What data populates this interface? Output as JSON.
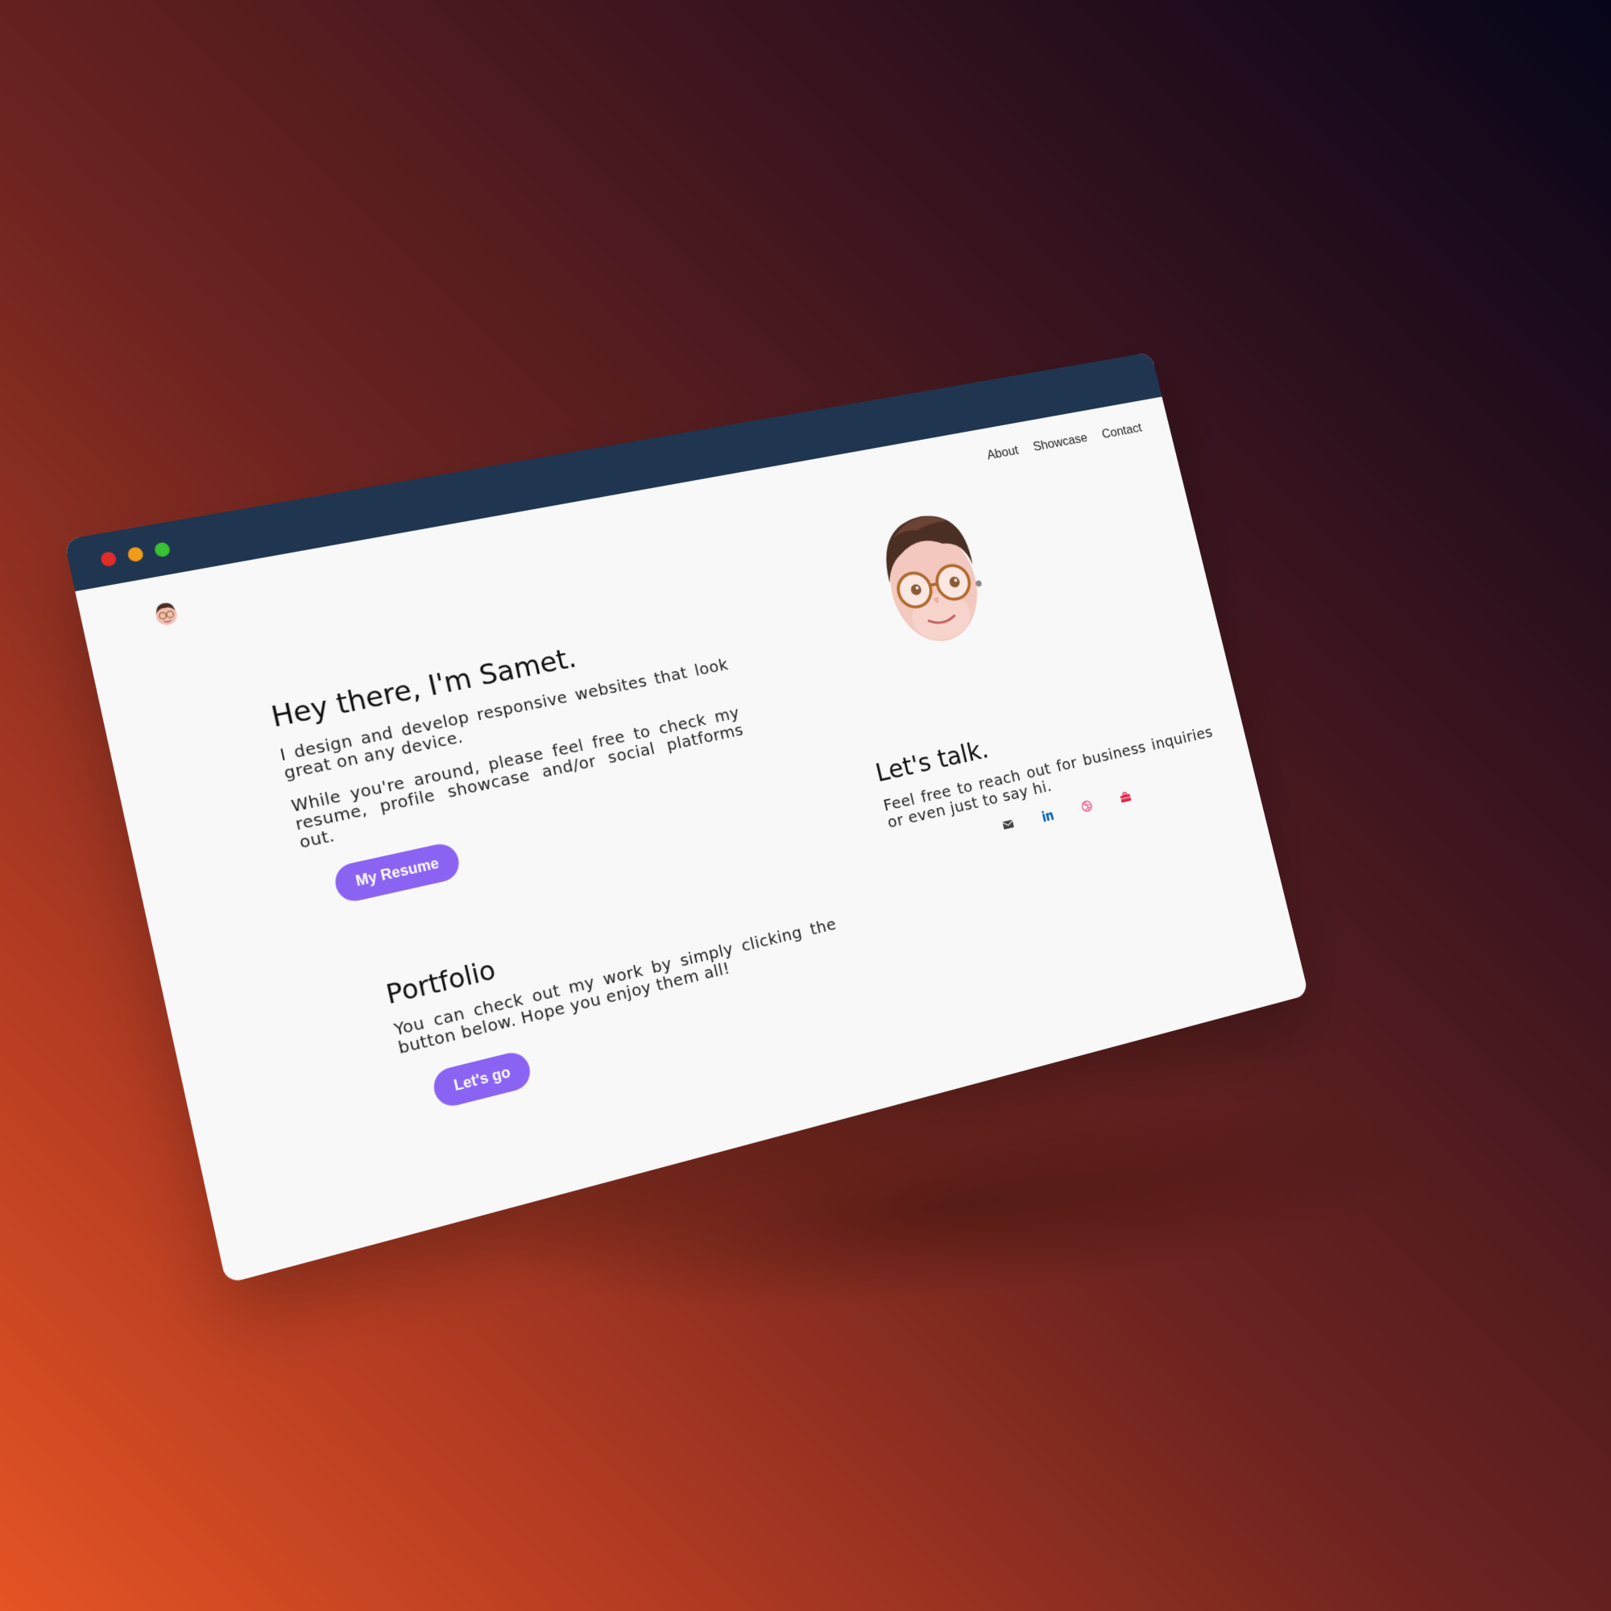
{
  "window": {
    "controls": [
      "close-dot",
      "minimize-dot",
      "maximize-dot"
    ]
  },
  "nav": {
    "items": [
      {
        "label": "About"
      },
      {
        "label": "Showcase"
      },
      {
        "label": "Contact"
      }
    ]
  },
  "hero": {
    "title": "Hey there, I'm Samet.",
    "paragraph1": "I design and develop responsive websites that look great on any device.",
    "paragraph2": "While you're around, please feel free to check my resume, profile showcase and/or social platforms out.",
    "button_label": "My Resume"
  },
  "portfolio": {
    "title": "Portfolio",
    "text": "You can check out my work by simply clicking the button below. Hope you enjoy them all!",
    "button_label": "Let's go"
  },
  "contact": {
    "title": "Let's talk.",
    "text": "Feel free to reach out for business inquiries or even just to say hi.",
    "socials": [
      {
        "icon": "envelope-icon",
        "color": "#444444"
      },
      {
        "icon": "linkedin-icon",
        "color": "#0a66c2"
      },
      {
        "icon": "dribbble-icon",
        "color": "#ea4c89"
      },
      {
        "icon": "briefcase-icon",
        "color": "#e0284b"
      }
    ]
  },
  "colors": {
    "accent": "#8b63f2",
    "titlebar": "#1f3550",
    "page_bg": "#f8f8f8"
  }
}
